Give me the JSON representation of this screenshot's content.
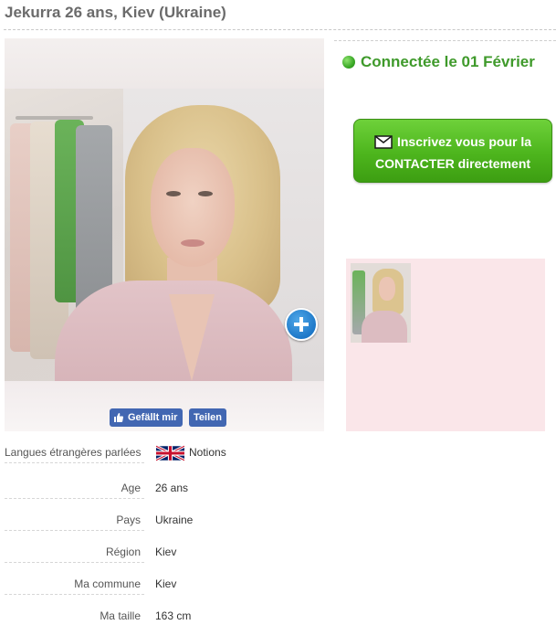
{
  "header": {
    "title": "Jekurra 26 ans, Kiev (Ukraine)"
  },
  "status": {
    "online_text": "Connectée le 01 Février",
    "color": "#3f9a2b"
  },
  "contact_button": {
    "line1": "Inscrivez vous pour la",
    "line2": "CONTACTER directement",
    "icon": "envelope-icon",
    "color": "#4db51d"
  },
  "photo": {
    "zoom_icon": "plus-circle-icon"
  },
  "social": {
    "like_label": "Gefällt mir",
    "share_label": "Teilen",
    "color": "#4267b2"
  },
  "thumbnail_panel": {
    "background": "#fae6e9"
  },
  "profile": {
    "rows": [
      {
        "label": "Langues étrangères parlées",
        "value": "Notions",
        "flag": "uk-flag-icon"
      },
      {
        "label": "Age",
        "value": "26 ans"
      },
      {
        "label": "Pays",
        "value": "Ukraine"
      },
      {
        "label": "Région",
        "value": "Kiev"
      },
      {
        "label": "Ma commune",
        "value": "Kiev"
      },
      {
        "label": "Ma taille",
        "value": "163 cm"
      }
    ]
  }
}
